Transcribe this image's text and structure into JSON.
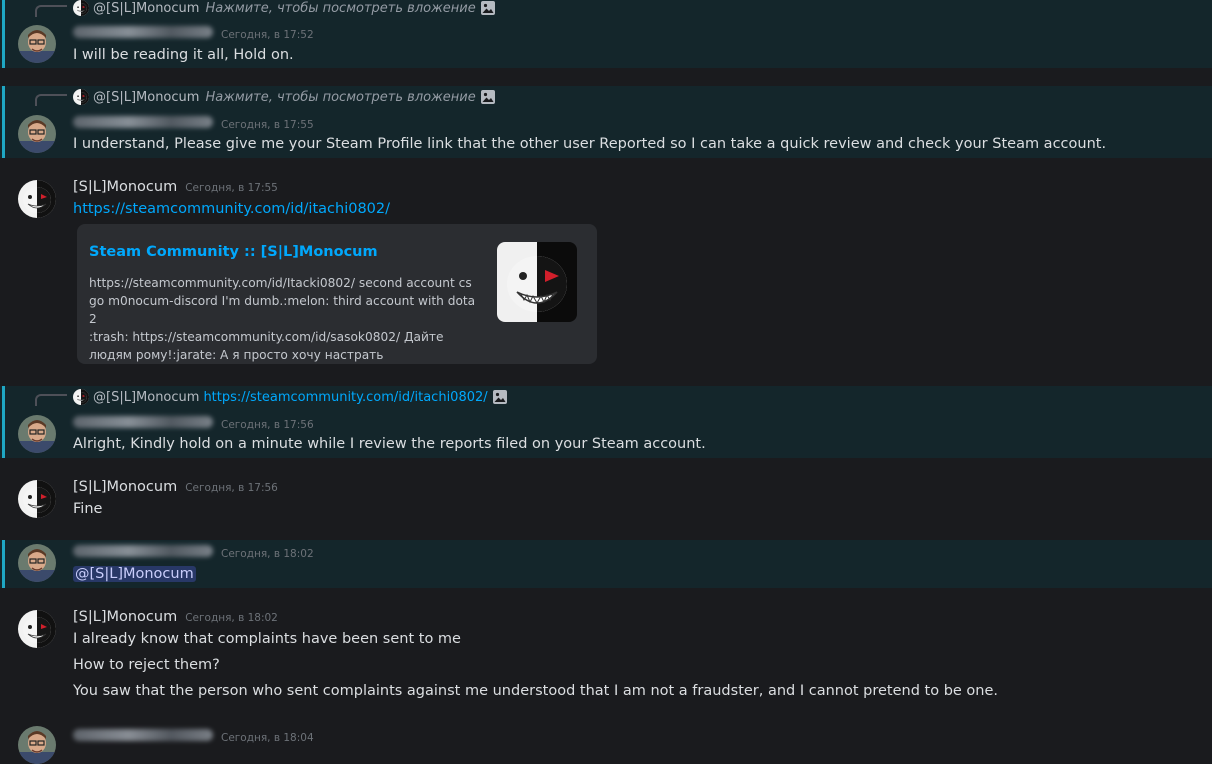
{
  "colors": {
    "background": "#1a1b1e",
    "highlight": "#14262b",
    "accent_bar": "#1fa7c4",
    "link": "#00a8fc"
  },
  "messages": [
    {
      "reply": {
        "author": "@[S|L]Monocum",
        "hint": "Нажмите, чтобы посмотреть вложение"
      },
      "time": "Сегодня, в 17:52",
      "text": "I will be reading it all, Hold on."
    },
    {
      "reply": {
        "author": "@[S|L]Monocum",
        "hint": "Нажмите, чтобы посмотреть вложение"
      },
      "time": "Сегодня, в 17:55",
      "text": "I understand, Please give me your Steam Profile link that the other user Reported so I can take a quick review and check your Steam account."
    },
    {
      "author": "[S|L]Monocum",
      "time": "Сегодня, в 17:55",
      "link": "https://steamcommunity.com/id/itachi0802/",
      "embed": {
        "title": "Steam Community :: [S|L]Monocum",
        "lines": [
          "https://steamcommunity.com/id/Itacki0802/ second account cs",
          "go m0nocum-discord I'm dumb.:melon: third account with dota 2",
          ":trash: https://steamcommunity.com/id/sasok0802/ Дайте",
          "людям рому!:jarate: А я просто хочу настрать"
        ]
      }
    },
    {
      "reply": {
        "author": "@[S|L]Monocum",
        "link": "https://steamcommunity.com/id/itachi0802/"
      },
      "time": "Сегодня, в 17:56",
      "text": "Alright, Kindly hold on a minute while I review the reports filed on your Steam account."
    },
    {
      "author": "[S|L]Monocum",
      "time": "Сегодня, в 17:56",
      "text": "Fine"
    },
    {
      "time": "Сегодня, в 18:02",
      "mention": "@[S|L]Monocum"
    },
    {
      "author": "[S|L]Monocum",
      "time": "Сегодня, в 18:02",
      "lines": [
        "I already know that complaints have been sent to me",
        "How to reject them?",
        "You saw that the person who sent complaints against me understood that I am not a fraudster, and I cannot pretend to be one."
      ]
    },
    {
      "time": "Сегодня, в 18:04"
    }
  ]
}
